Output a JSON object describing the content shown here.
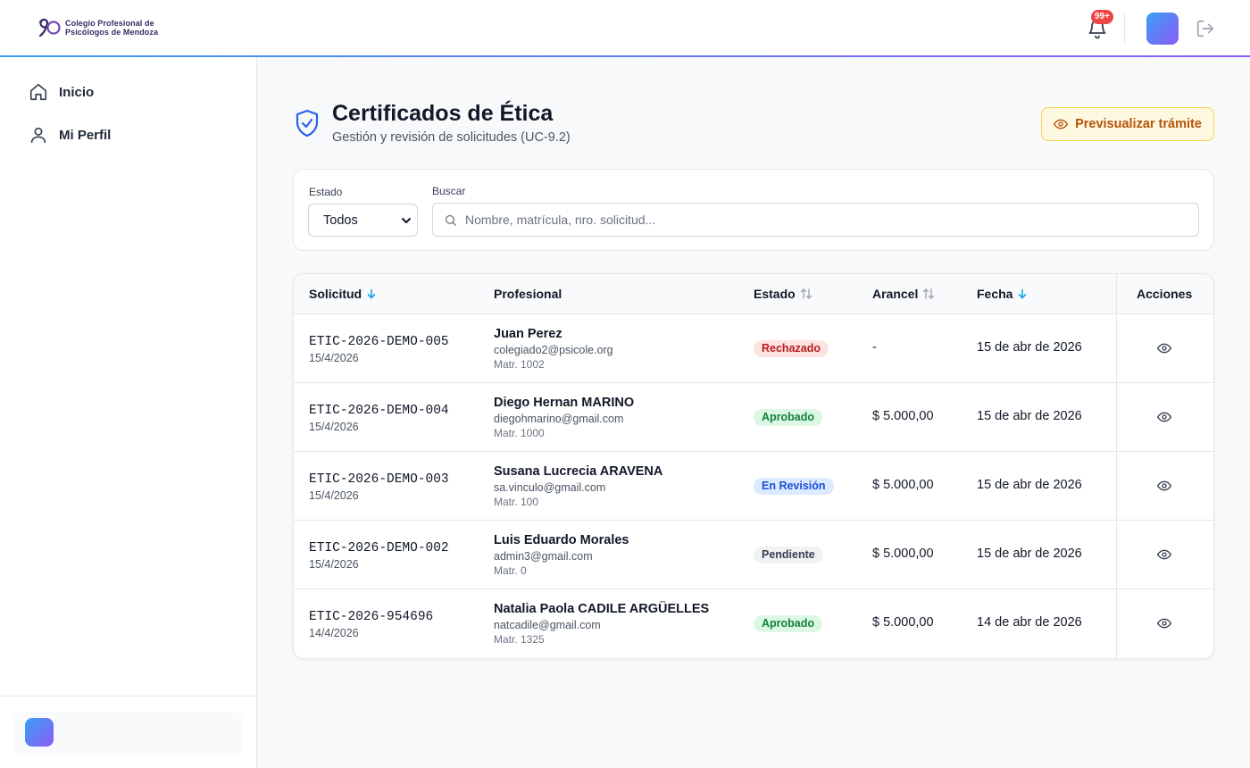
{
  "brand": {
    "line1": "Colegio Profesional de",
    "line2": "Psicólogos de Mendoza"
  },
  "notifications": {
    "badge": "99+"
  },
  "sidebar": {
    "items": [
      {
        "label": "Inicio",
        "icon": "home-icon"
      },
      {
        "label": "Mi Perfil",
        "icon": "user-icon"
      }
    ]
  },
  "header": {
    "title": "Certificados de Ética",
    "subtitle": "Gestión y revisión de solicitudes (UC-9.2)",
    "preview_button": "Previsualizar trámite"
  },
  "filters": {
    "status_label": "Estado",
    "status_value": "Todos",
    "search_label": "Buscar",
    "search_placeholder": "Nombre, matrícula, nro. solicitud..."
  },
  "table": {
    "columns": [
      "Solicitud",
      "Profesional",
      "Estado",
      "Arancel",
      "Fecha",
      "Acciones"
    ],
    "rows": [
      {
        "id": "ETIC-2026-DEMO-005",
        "date": "15/4/2026",
        "name": "Juan Perez",
        "email": "colegiado2@psicole.org",
        "matricula": "Matr. 1002",
        "status": "Rechazado",
        "fee": "-",
        "fecha": "15 de abr de 2026"
      },
      {
        "id": "ETIC-2026-DEMO-004",
        "date": "15/4/2026",
        "name": "Diego Hernan MARINO",
        "email": "diegohmarino@gmail.com",
        "matricula": "Matr. 1000",
        "status": "Aprobado",
        "fee": "$ 5.000,00",
        "fecha": "15 de abr de 2026"
      },
      {
        "id": "ETIC-2026-DEMO-003",
        "date": "15/4/2026",
        "name": "Susana Lucrecia ARAVENA",
        "email": "sa.vinculo@gmail.com",
        "matricula": "Matr. 100",
        "status": "En Revisión",
        "fee": "$ 5.000,00",
        "fecha": "15 de abr de 2026"
      },
      {
        "id": "ETIC-2026-DEMO-002",
        "date": "15/4/2026",
        "name": "Luis Eduardo Morales",
        "email": "admin3@gmail.com",
        "matricula": "Matr. 0",
        "status": "Pendiente",
        "fee": "$ 5.000,00",
        "fecha": "15 de abr de 2026"
      },
      {
        "id": "ETIC-2026-954696",
        "date": "14/4/2026",
        "name": "Natalia Paola CADILE ARGÜELLES",
        "email": "natcadile@gmail.com",
        "matricula": "Matr. 1325",
        "status": "Aprobado",
        "fee": "$ 5.000,00",
        "fecha": "14 de abr de 2026"
      }
    ]
  },
  "colors": {
    "accent_start": "#3b9ef5",
    "accent_end": "#8b5cf6",
    "sort_active": "#0ea5e9",
    "preview_text": "#b45309"
  }
}
